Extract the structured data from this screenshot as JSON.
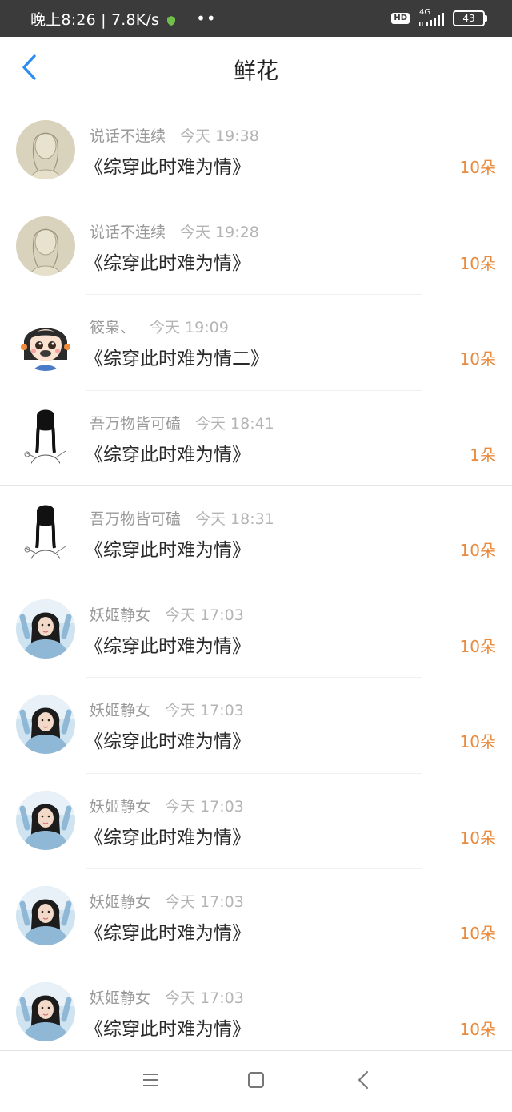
{
  "status_bar": {
    "time_speed": "晚上8:26 | 7.8K/s",
    "dots": "••",
    "hd_label": "HD",
    "network_label": "4G",
    "battery": "43",
    "icons": [
      "shield-icon",
      "signal-icon",
      "battery-icon"
    ]
  },
  "header": {
    "title": "鲜花",
    "back_icon": "chevron-left-icon"
  },
  "colors": {
    "accent_blue": "#2d8cf0",
    "amount_orange": "#e98a3c"
  },
  "records": [
    {
      "user": "说话不连续",
      "time": "今天 19:38",
      "book": "《综穿此时难为情》",
      "amount": "10朵",
      "avatar": "sketch-portrait"
    },
    {
      "user": "说话不连续",
      "time": "今天 19:28",
      "book": "《综穿此时难为情》",
      "amount": "10朵",
      "avatar": "sketch-portrait"
    },
    {
      "user": "筱枭、",
      "time": "今天 19:09",
      "book": "《综穿此时难为情二》",
      "amount": "10朵",
      "avatar": "cartoon-girl"
    },
    {
      "user": "吾万物皆可磕",
      "time": "今天 18:41",
      "book": "《综穿此时难为情》",
      "amount": "1朵",
      "avatar": "braids-sketch"
    },
    {
      "user": "吾万物皆可磕",
      "time": "今天 18:31",
      "book": "《综穿此时难为情》",
      "amount": "10朵",
      "avatar": "braids-sketch"
    },
    {
      "user": "妖姬静女",
      "time": "今天 17:03",
      "book": "《综穿此时难为情》",
      "amount": "10朵",
      "avatar": "girl-photo"
    },
    {
      "user": "妖姬静女",
      "time": "今天 17:03",
      "book": "《综穿此时难为情》",
      "amount": "10朵",
      "avatar": "girl-photo"
    },
    {
      "user": "妖姬静女",
      "time": "今天 17:03",
      "book": "《综穿此时难为情》",
      "amount": "10朵",
      "avatar": "girl-photo"
    },
    {
      "user": "妖姬静女",
      "time": "今天 17:03",
      "book": "《综穿此时难为情》",
      "amount": "10朵",
      "avatar": "girl-photo"
    },
    {
      "user": "妖姬静女",
      "time": "今天 17:03",
      "book": "《综穿此时难为情》",
      "amount": "10朵",
      "avatar": "girl-photo"
    }
  ],
  "nav_keys": [
    "menu-icon",
    "home-square-icon",
    "back-triangle-icon"
  ]
}
